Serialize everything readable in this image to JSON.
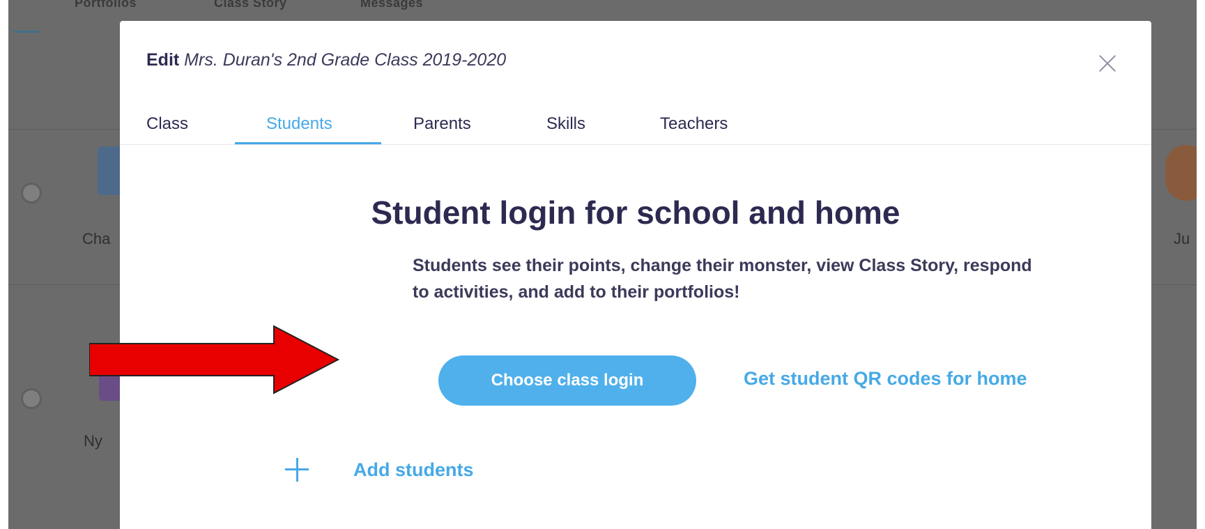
{
  "background": {
    "nav_items": [
      "Portfolios",
      "Class Story",
      "Messages"
    ],
    "student_names_partial": [
      "Cha",
      "Ny",
      "Ju"
    ]
  },
  "modal": {
    "title_prefix": "Edit",
    "class_name": "Mrs. Duran's 2nd Grade Class 2019-2020",
    "close_icon": "close-icon",
    "tabs": [
      {
        "label": "Class",
        "active": false
      },
      {
        "label": "Students",
        "active": true
      },
      {
        "label": "Parents",
        "active": false
      },
      {
        "label": "Skills",
        "active": false
      },
      {
        "label": "Teachers",
        "active": false
      }
    ],
    "headline": "Student login for school and home",
    "subtext": "Students see their points, change their monster, view Class Story, respond to activities, and add to their portfolios!",
    "primary_button": "Choose class login",
    "secondary_link": "Get student QR codes for home",
    "add_students_label": "Add students",
    "add_icon": "plus-icon"
  },
  "annotation": {
    "icon": "arrow-right-icon",
    "color": "#e80000"
  },
  "colors": {
    "accent": "#46a9e6",
    "primary_button": "#4fb0ec",
    "text_dark": "#2c2a50",
    "backdrop": "#6b6b6b"
  }
}
